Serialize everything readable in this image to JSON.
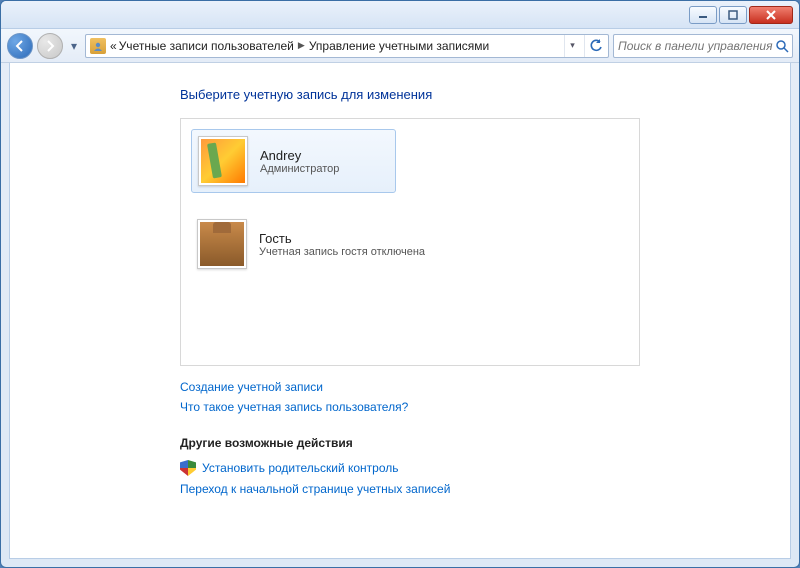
{
  "breadcrumb": {
    "prefix": "«",
    "part1": "Учетные записи пользователей",
    "part2": "Управление учетными записями"
  },
  "search": {
    "placeholder": "Поиск в панели управления"
  },
  "page": {
    "heading": "Выберите учетную запись для изменения"
  },
  "accounts": [
    {
      "name": "Andrey",
      "subtitle": "Администратор"
    },
    {
      "name": "Гость",
      "subtitle": "Учетная запись гостя отключена"
    }
  ],
  "links": {
    "create": "Создание учетной записи",
    "what_is": "Что такое учетная запись пользователя?"
  },
  "other": {
    "header": "Другие возможные действия",
    "parental": "Установить родительский контроль",
    "goto_main": "Переход к начальной странице учетных записей"
  }
}
